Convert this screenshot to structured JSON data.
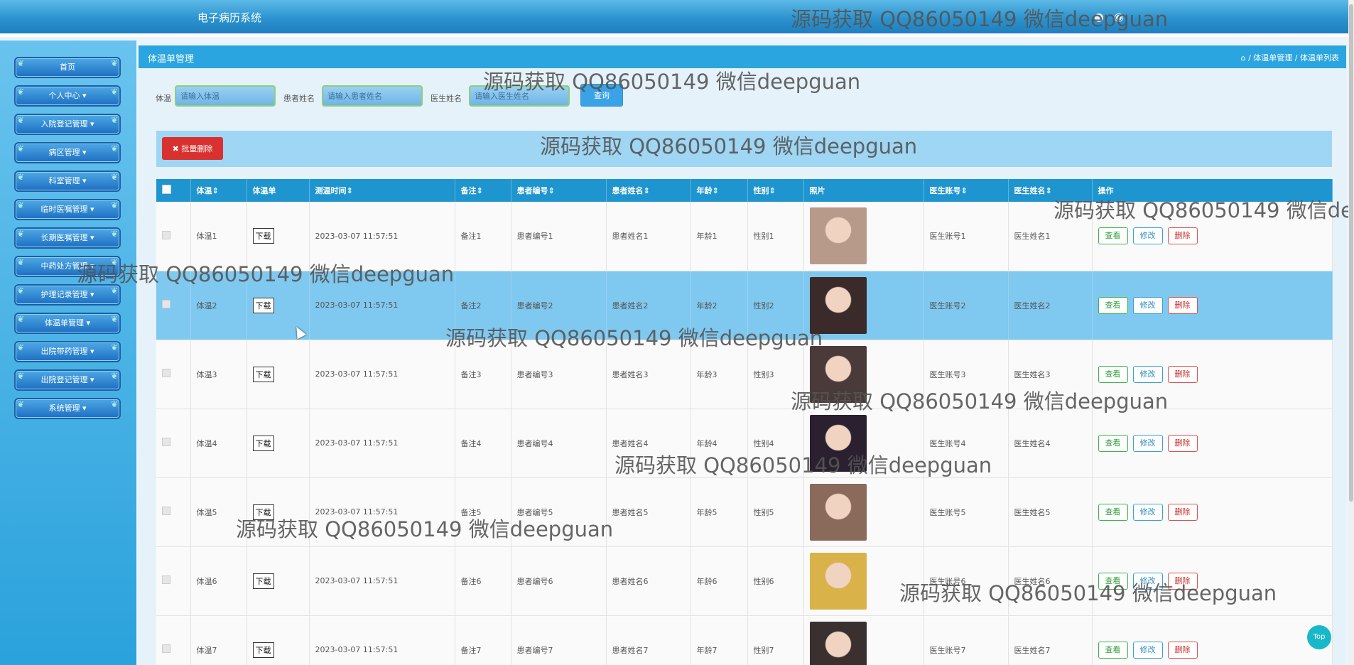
{
  "header": {
    "app_title": "电子病历系统"
  },
  "sidebar": {
    "items": [
      {
        "label": "首页"
      },
      {
        "label": "个人中心 ▾"
      },
      {
        "label": "入院登记管理 ▾"
      },
      {
        "label": "病区管理 ▾"
      },
      {
        "label": "科室管理 ▾"
      },
      {
        "label": "临时医嘱管理 ▾"
      },
      {
        "label": "长期医嘱管理 ▾"
      },
      {
        "label": "中药处方管理 ▾"
      },
      {
        "label": "护理记录管理 ▾"
      },
      {
        "label": "体温单管理 ▾"
      },
      {
        "label": "出院带药管理 ▾"
      },
      {
        "label": "出院登记管理 ▾"
      },
      {
        "label": "系统管理 ▾"
      }
    ]
  },
  "page": {
    "title": "体温单管理",
    "breadcrumb": "⌂ / 体温单管理 / 体温单列表"
  },
  "search": {
    "temp_label": "体温",
    "temp_placeholder": "请输入体温",
    "patient_label": "患者姓名",
    "patient_placeholder": "请输入患者姓名",
    "doctor_label": "医生姓名",
    "doctor_placeholder": "请输入医生姓名",
    "query_button": "查询"
  },
  "batch_delete": "✖ 批量删除",
  "table": {
    "headers": [
      "体温⇕",
      "体温单",
      "测温时间⇕",
      "备注⇕",
      "患者编号⇕",
      "患者姓名⇕",
      "年龄⇕",
      "性别⇕",
      "照片",
      "医生账号⇕",
      "医生姓名⇕",
      "操作"
    ],
    "download_label": "下载",
    "actions": {
      "view": "查看",
      "edit": "修改",
      "delete": "删除"
    },
    "rows": [
      {
        "temp": "体温1",
        "time": "2023-03-07 11:57:51",
        "note": "备注1",
        "pid": "患者编号1",
        "pname": "患者姓名1",
        "age": "年龄1",
        "sex": "性别1",
        "doc_acct": "医生账号1",
        "doc_name": "医生姓名1",
        "photo_color": "#b89a8a"
      },
      {
        "temp": "体温2",
        "time": "2023-03-07 11:57:51",
        "note": "备注2",
        "pid": "患者编号2",
        "pname": "患者姓名2",
        "age": "年龄2",
        "sex": "性别2",
        "doc_acct": "医生账号2",
        "doc_name": "医生姓名2",
        "photo_color": "#3a2a2a"
      },
      {
        "temp": "体温3",
        "time": "2023-03-07 11:57:51",
        "note": "备注3",
        "pid": "患者编号3",
        "pname": "患者姓名3",
        "age": "年龄3",
        "sex": "性别3",
        "doc_acct": "医生账号3",
        "doc_name": "医生姓名3",
        "photo_color": "#4a3a3a"
      },
      {
        "temp": "体温4",
        "time": "2023-03-07 11:57:51",
        "note": "备注4",
        "pid": "患者编号4",
        "pname": "患者姓名4",
        "age": "年龄4",
        "sex": "性别4",
        "doc_acct": "医生账号4",
        "doc_name": "医生姓名4",
        "photo_color": "#2a2030"
      },
      {
        "temp": "体温5",
        "time": "2023-03-07 11:57:51",
        "note": "备注5",
        "pid": "患者编号5",
        "pname": "患者姓名5",
        "age": "年龄5",
        "sex": "性别5",
        "doc_acct": "医生账号5",
        "doc_name": "医生姓名5",
        "photo_color": "#8a6a5a"
      },
      {
        "temp": "体温6",
        "time": "2023-03-07 11:57:51",
        "note": "备注6",
        "pid": "患者编号6",
        "pname": "患者姓名6",
        "age": "年龄6",
        "sex": "性别6",
        "doc_acct": "医生账号6",
        "doc_name": "医生姓名6",
        "photo_color": "#d9b24a"
      },
      {
        "temp": "体温7",
        "time": "2023-03-07 11:57:51",
        "note": "备注7",
        "pid": "患者编号7",
        "pname": "患者姓名7",
        "age": "年龄7",
        "sex": "性别7",
        "doc_acct": "医生账号7",
        "doc_name": "医生姓名7",
        "photo_color": "#3a3030"
      }
    ]
  },
  "watermark": "源码获取 QQ86050149 微信deepguan",
  "top_button": "Top"
}
